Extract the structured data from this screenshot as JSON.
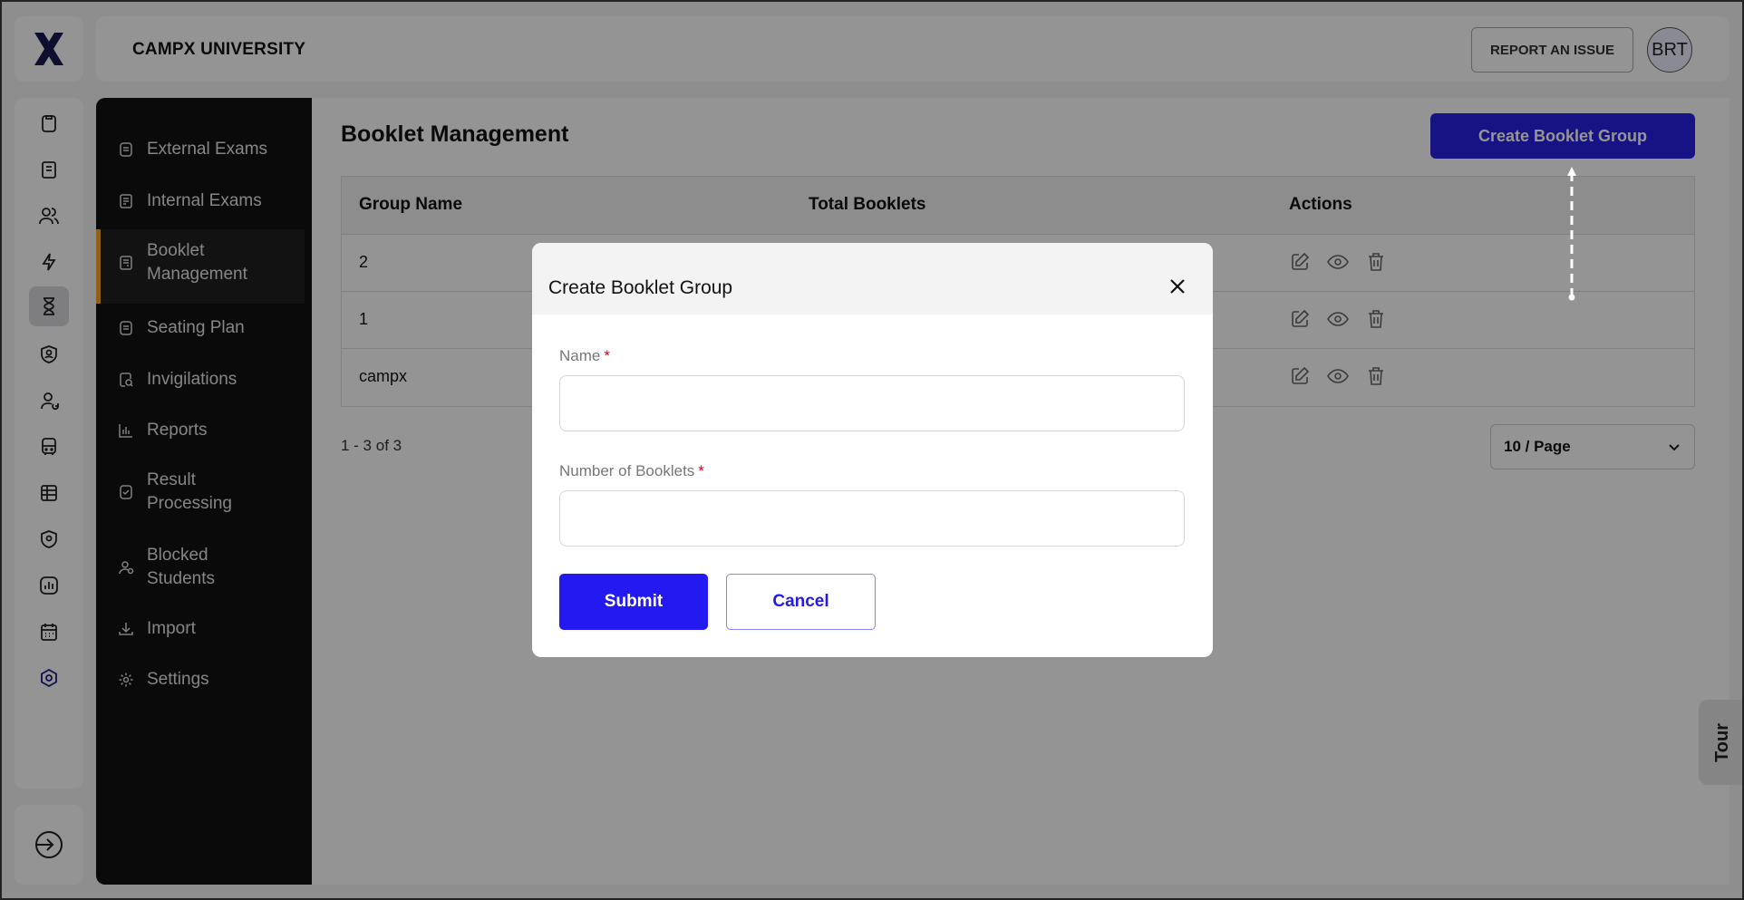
{
  "header": {
    "org_name": "CAMPX UNIVERSITY",
    "report_label": "REPORT AN ISSUE",
    "avatar_initials": "BRT"
  },
  "rail": {
    "icons": [
      "clipboard-icon",
      "notebook-icon",
      "users-icon",
      "lightning-icon",
      "hourglass-icon",
      "shield-user-icon",
      "user-refresh-icon",
      "bus-icon",
      "spreadsheet-icon",
      "shield-location-icon",
      "chart-icon",
      "calendar-icon",
      "hexagon-settings-icon"
    ],
    "active_icon": "hourglass-icon",
    "logout_icon": "logout-icon"
  },
  "sidebar": {
    "items": [
      {
        "label": "External Exams",
        "icon": "clipboard-icon"
      },
      {
        "label": "Internal Exams",
        "icon": "document-icon"
      },
      {
        "label": "Booklet Management",
        "icon": "booklet-icon",
        "active": true
      },
      {
        "label": "Seating Plan",
        "icon": "clipboard-icon"
      },
      {
        "label": "Invigilations",
        "icon": "search-doc-icon"
      },
      {
        "label": "Reports",
        "icon": "bar-chart-icon"
      },
      {
        "label": "Result Processing",
        "icon": "clipboard-check-icon"
      },
      {
        "label": "Blocked Students",
        "icon": "user-block-icon"
      },
      {
        "label": "Import",
        "icon": "download-icon"
      },
      {
        "label": "Settings",
        "icon": "gear-icon"
      }
    ]
  },
  "main": {
    "title": "Booklet Management",
    "create_button": "Create Booklet Group",
    "table": {
      "columns": [
        "Group Name",
        "Total Booklets",
        "Actions"
      ],
      "rows": [
        {
          "group_name": "2"
        },
        {
          "group_name": "1"
        },
        {
          "group_name": "campx"
        }
      ]
    },
    "pagination_text": "1 - 3 of 3",
    "per_page": "10 / Page"
  },
  "tour_label": "Tour",
  "modal": {
    "title": "Create Booklet Group",
    "name_label": "Name",
    "booklets_label": "Number of Booklets",
    "required_mark": "*",
    "name_value": "",
    "booklets_value": "",
    "submit_label": "Submit",
    "cancel_label": "Cancel"
  },
  "colors": {
    "accent": "#2519f2",
    "nav_bg": "#121212",
    "active_marker": "#f5a623",
    "required": "#d0021b"
  }
}
